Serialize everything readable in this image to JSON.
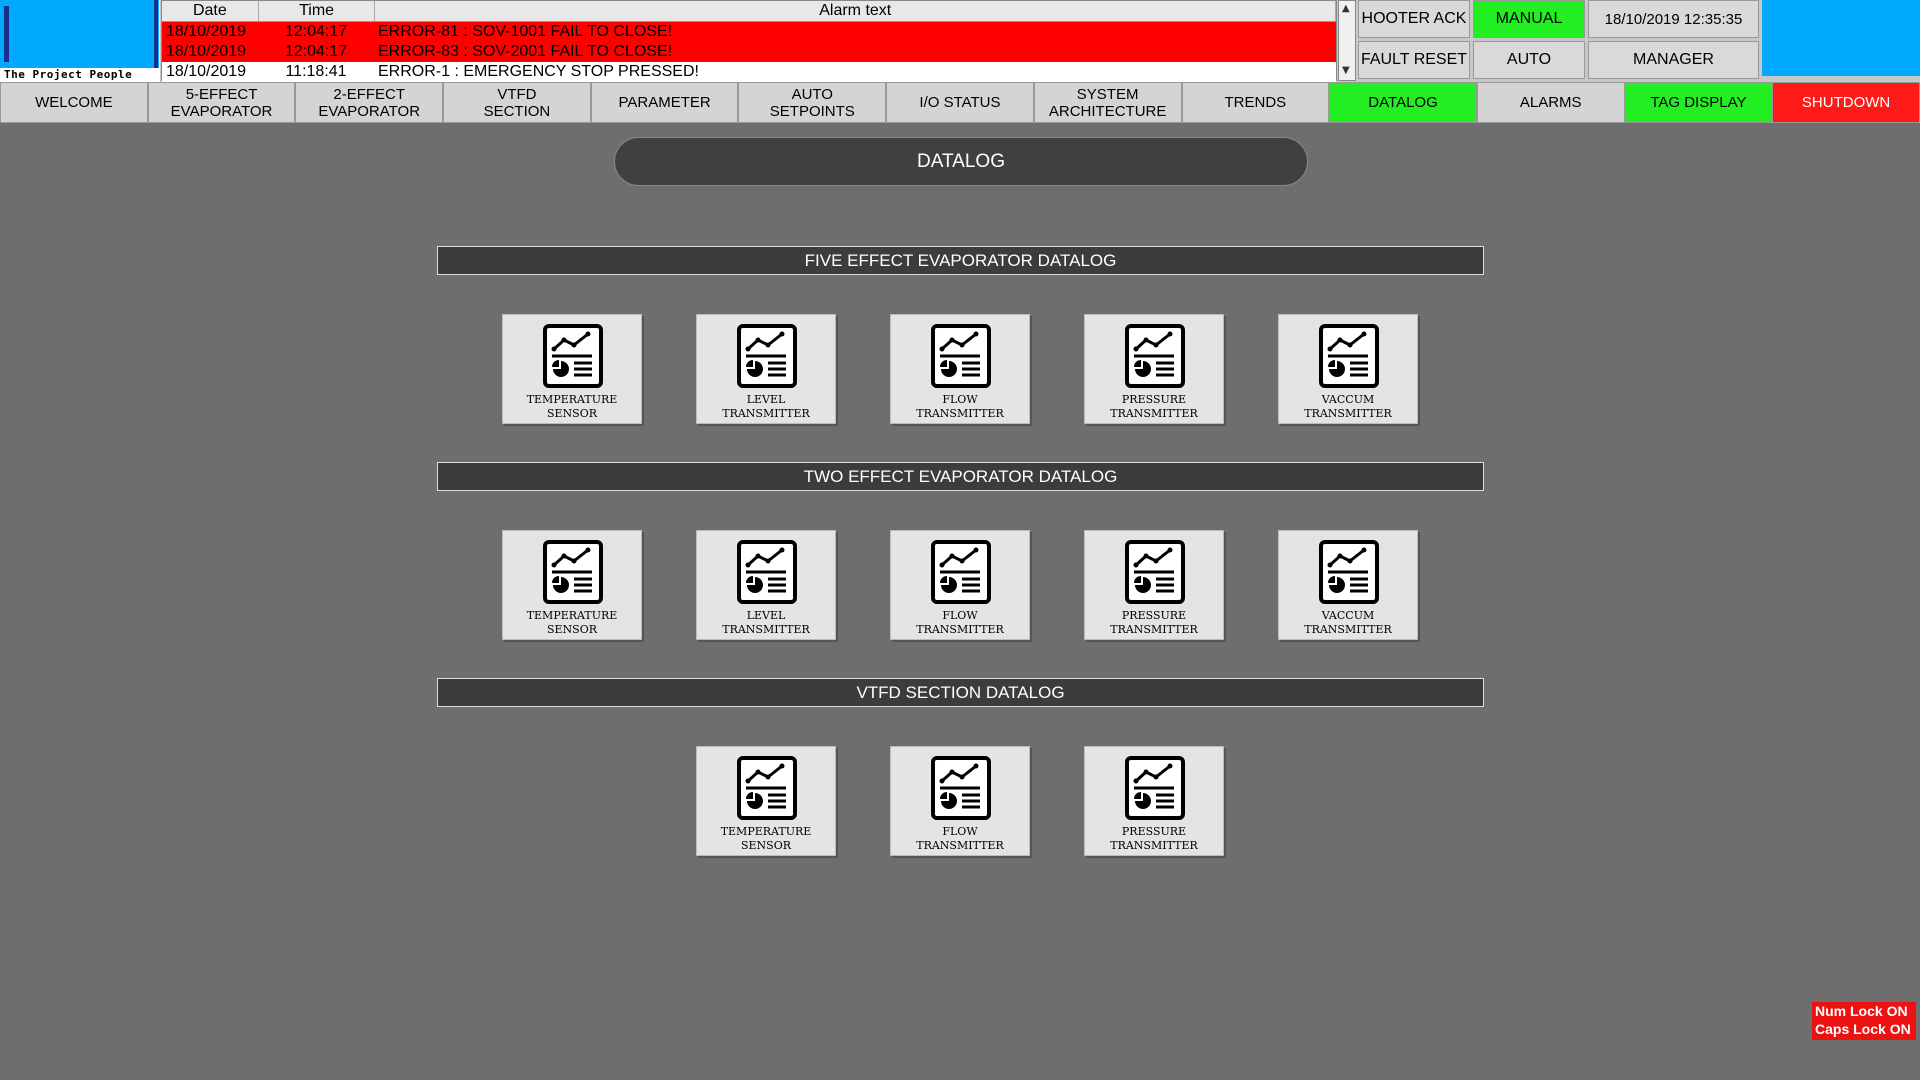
{
  "logo": {
    "caption": "The Project People"
  },
  "alarm_table": {
    "headers": [
      "Date",
      "Time",
      "Alarm text"
    ],
    "rows": [
      {
        "date": "18/10/2019",
        "time": "12:04:17",
        "text": "ERROR-81 : SOV-1001 FAIL TO CLOSE!",
        "status": "active"
      },
      {
        "date": "18/10/2019",
        "time": "12:04:17",
        "text": "ERROR-83 : SOV-2001 FAIL TO CLOSE!",
        "status": "active"
      },
      {
        "date": "18/10/2019",
        "time": "11:18:41",
        "text": "ERROR-1 : EMERGENCY STOP PRESSED!",
        "status": "normal"
      }
    ]
  },
  "controls": {
    "hooter_ack": "HOOTER ACK",
    "manual": "MANUAL",
    "datetime": "18/10/2019 12:35:35",
    "fault_reset": "FAULT RESET",
    "auto": "AUTO",
    "user": "MANAGER"
  },
  "nav": [
    {
      "label": "WELCOME",
      "state": "normal"
    },
    {
      "label": "5-EFFECT\nEVAPORATOR",
      "state": "normal"
    },
    {
      "label": "2-EFFECT\nEVAPORATOR",
      "state": "normal"
    },
    {
      "label": "VTFD\nSECTION",
      "state": "normal"
    },
    {
      "label": "PARAMETER",
      "state": "normal"
    },
    {
      "label": "AUTO\nSETPOINTS",
      "state": "normal"
    },
    {
      "label": "I/O STATUS",
      "state": "normal"
    },
    {
      "label": "SYSTEM\nARCHITECTURE",
      "state": "normal"
    },
    {
      "label": "TRENDS",
      "state": "normal"
    },
    {
      "label": "DATALOG",
      "state": "green"
    },
    {
      "label": "ALARMS",
      "state": "normal"
    },
    {
      "label": "TAG DISPLAY",
      "state": "green"
    },
    {
      "label": "SHUTDOWN",
      "state": "red"
    }
  ],
  "page_title": "DATALOG",
  "sections": [
    {
      "title": "FIVE EFFECT EVAPORATOR DATALOG",
      "items": [
        "TEMPERATURE\nSENSOR",
        "LEVEL\nTRANSMITTER",
        "FLOW\nTRANSMITTER",
        "PRESSURE\nTRANSMITTER",
        "VACCUM\nTRANSMITTER"
      ]
    },
    {
      "title": "TWO EFFECT EVAPORATOR DATALOG",
      "items": [
        "TEMPERATURE\nSENSOR",
        "LEVEL\nTRANSMITTER",
        "FLOW\nTRANSMITTER",
        "PRESSURE\nTRANSMITTER",
        "VACCUM\nTRANSMITTER"
      ]
    },
    {
      "title": "VTFD SECTION DATALOG",
      "items": [
        "TEMPERATURE\nSENSOR",
        "FLOW\nTRANSMITTER",
        "PRESSURE\nTRANSMITTER"
      ]
    }
  ],
  "status": {
    "num_lock": "Num Lock ON",
    "caps_lock": "Caps Lock ON"
  },
  "colors": {
    "background": "#6e6e6e",
    "active_alarm": "#ff0000",
    "active_button": "#22ee22",
    "shutdown": "#ff1a1a",
    "brand_blue": "#00aaff"
  },
  "icons": {
    "card_icon": "report-chart-icon"
  }
}
